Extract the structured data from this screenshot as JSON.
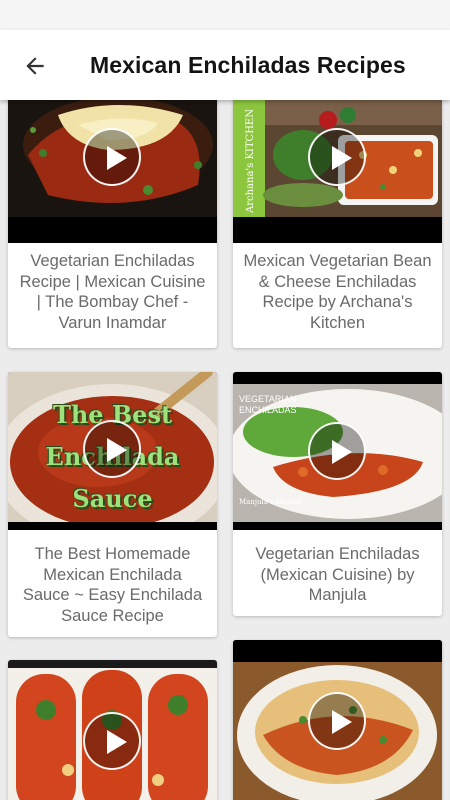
{
  "header": {
    "back_icon": "arrow-left-icon",
    "title": "Mexican Enchiladas Recipes"
  },
  "cards": [
    {
      "title": "Vegetarian Enchiladas Recipe | Mexican Cuisine | The Bombay Chef - Varun Inamdar",
      "play_icon": "play-icon"
    },
    {
      "title": "Mexican Vegetarian Bean & Cheese Enchiladas Recipe by Archana's Kitchen",
      "play_icon": "play-icon",
      "thumb_text": "Archana's KITCHEN"
    },
    {
      "title": "The Best Homemade Mexican Enchilada Sauce ~ Easy Enchilada Sauce Recipe",
      "play_icon": "play-icon",
      "thumb_text_lines": [
        "The Best",
        "Enchilada",
        "Sauce"
      ]
    },
    {
      "title": "Vegetarian Enchiladas (Mexican Cuisine) by Manjula",
      "play_icon": "play-icon",
      "thumb_text_lines": [
        "VEGETARIAN",
        "ENCHILADAS"
      ],
      "thumb_logo": "Manjula's kitchen"
    },
    {
      "title": "",
      "play_icon": "play-icon"
    },
    {
      "title": "",
      "play_icon": "play-icon"
    }
  ],
  "colors": {
    "background": "#ececec",
    "card": "#ffffff",
    "title_text": "#141414",
    "card_text": "#6a6a6a",
    "accent_green": "#8cc63f"
  }
}
